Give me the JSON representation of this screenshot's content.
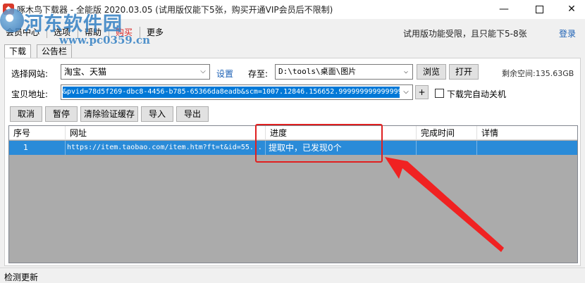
{
  "window": {
    "title": "啄木鸟下载器 - 全能版 2020.03.05 (试用版仅能下5张，购买开通VIP会员后不限制)",
    "min_glyph": "—",
    "close_glyph": "✕"
  },
  "watermark": {
    "name": "河东软件园",
    "url": "www.pc0359.cn"
  },
  "menu": {
    "items": [
      {
        "label": "会员中心"
      },
      {
        "label": "选项"
      },
      {
        "label": "帮助"
      },
      {
        "label": "购买"
      },
      {
        "label": "更多"
      }
    ],
    "trial_note": "试用版功能受限，且只能下5-8张",
    "login": "登录"
  },
  "tabs": [
    {
      "label": "下载",
      "active": true
    },
    {
      "label": "公告栏",
      "active": false
    }
  ],
  "form": {
    "site_label": "选择网站:",
    "site_value": "淘宝、天猫",
    "settings_link": "设置",
    "save_to_label": "存至:",
    "save_to_value": "D:\\tools\\桌面\\图片",
    "browse_button": "浏览",
    "open_button": "打开",
    "free_space": "剩余空间:135.63GB",
    "url_label": "宝贝地址:",
    "url_value": "&pvid=78d5f269-dbc8-4456-b785-65366da8eadb&scm=1007.12846.156652.999999999999999",
    "plus_button": "+",
    "auto_shutdown_label": "下载完自动关机",
    "auto_shutdown_checked": false
  },
  "actions": {
    "cancel": "取消",
    "pause": "暂停",
    "clear_cache": "清除验证缓存",
    "import": "导入",
    "export": "导出"
  },
  "table": {
    "columns": [
      "序号",
      "网址",
      "进度",
      "完成时间",
      "详情"
    ],
    "rows": [
      {
        "index": "1",
        "url": "https://item.taobao.com/item.htm?ft=t&id=55...",
        "progress": "提取中，已发现0个",
        "done_time": "",
        "detail": ""
      }
    ]
  },
  "status": {
    "text": "检测更新"
  },
  "colors": {
    "selection": "#2a8bd8",
    "annotation": "#e02020",
    "link": "#1a5fb4"
  }
}
